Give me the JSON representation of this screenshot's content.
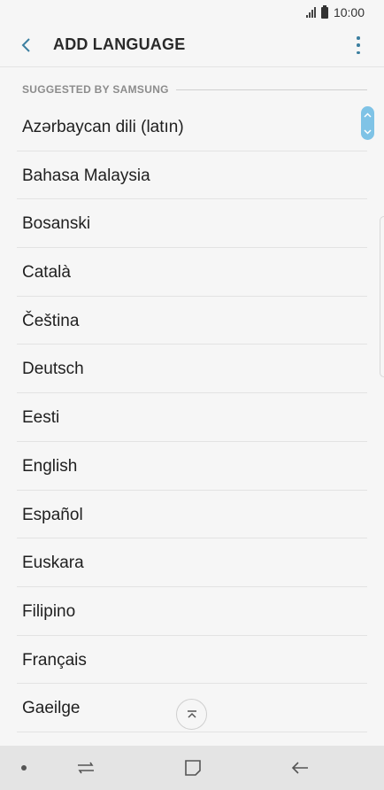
{
  "status_bar": {
    "time": "10:00"
  },
  "header": {
    "title": "ADD LANGUAGE"
  },
  "section": {
    "label": "SUGGESTED BY SAMSUNG"
  },
  "languages": [
    "Azərbaycan dili (latın)",
    "Bahasa Malaysia",
    "Bosanski",
    "Català",
    "Čeština",
    "Deutsch",
    "Eesti",
    "English",
    "Español",
    "Euskara",
    "Filipino",
    "Français",
    "Gaeilge"
  ],
  "icons": {
    "back": "arrow-left-icon",
    "more": "more-vertical-icon",
    "scroll_to_top": "chevron-up-icon",
    "recents": "recents-icon",
    "home": "home-icon",
    "nav_back": "nav-back-icon"
  },
  "colors": {
    "accent": "#3c7fa0",
    "scroll_thumb": "#7fc3e6"
  }
}
